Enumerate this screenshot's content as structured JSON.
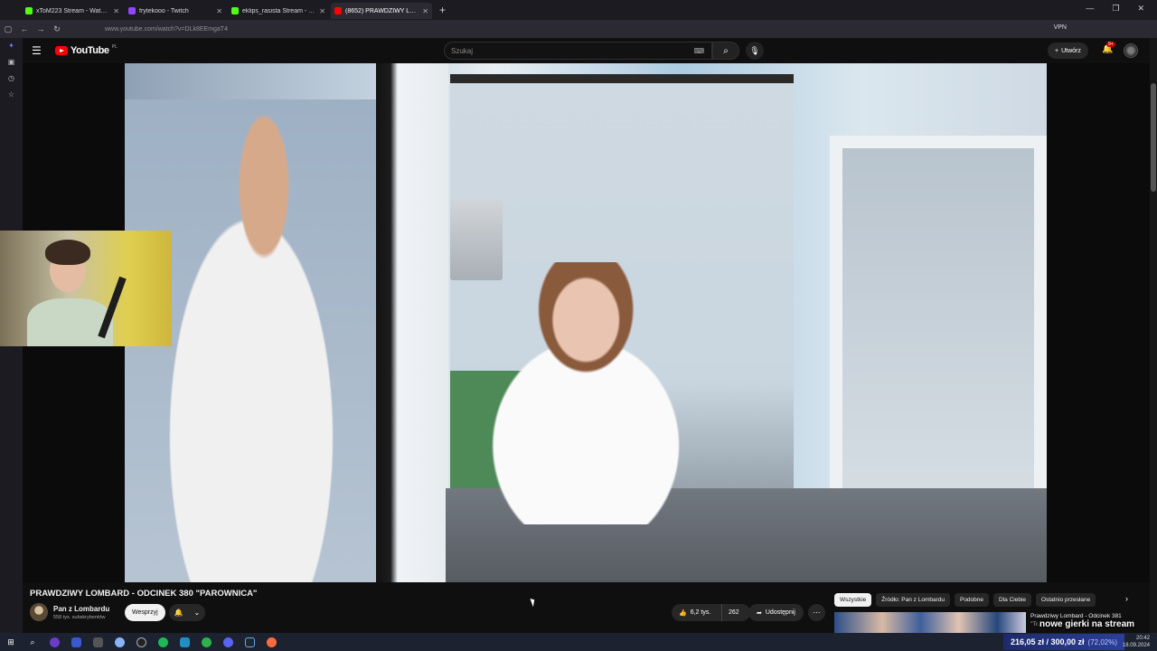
{
  "browser": {
    "tabs": [
      {
        "label": "xToM223 Stream - Watch L",
        "color": "#53fc18",
        "active": false
      },
      {
        "label": "frytekooo - Twitch",
        "color": "#9146ff",
        "active": false
      },
      {
        "label": "eklips_rasista Stream - Kick",
        "color": "#53fc18",
        "active": false
      },
      {
        "label": "(8652) PRAWDZIWY LOMB",
        "color": "#ff0000",
        "active": true
      }
    ],
    "new_tab": "+",
    "url": "www.youtube.com/watch?v=DLk8EEmgaT4",
    "vpn": "VPN"
  },
  "youtube": {
    "logo_text": "YouTube",
    "logo_country": "PL",
    "search_placeholder": "Szukaj",
    "create_label": "Utwórz",
    "notif_count": "9+"
  },
  "video": {
    "title": "PRAWDZIWY LOMBARD - ODCINEK 380 \"PAROWNICA\"",
    "channel_name": "Pan z Lombardu",
    "channel_subs": "558 tys. subskrybentów",
    "support_label": "Wesprzyj",
    "likes": "6,2 tys.",
    "comments": "262",
    "share_label": "Udostępnij"
  },
  "chips": [
    "Wszystkie",
    "Źródło: Pan z Lombardu",
    "Podobne",
    "Dla Ciebie",
    "Ostatnio przesłane"
  ],
  "recommended": {
    "title": "Prawdziwy Lombard - Odcinek 381",
    "subtitle": "\"Tr..."
  },
  "overlay": {
    "stream_text": "nowe gierki na stream",
    "donation_amount": "216,05 zł",
    "donation_goal": "300,00 zł",
    "donation_pct": "(72,02%)"
  },
  "clock": {
    "time": "20:42",
    "date": "18.09.2024"
  }
}
